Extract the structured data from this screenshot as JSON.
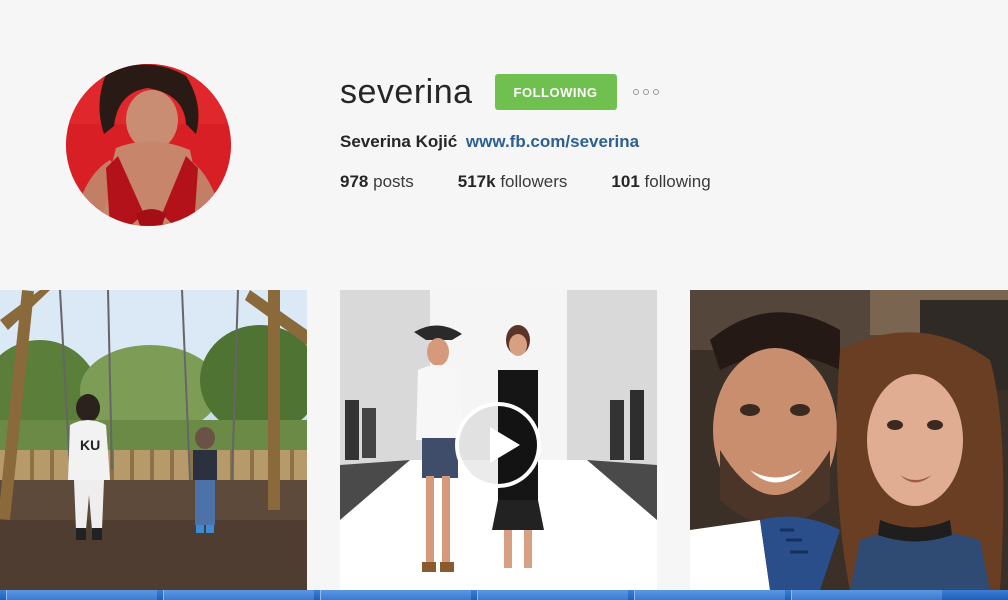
{
  "profile": {
    "username": "severina",
    "follow_label": "FOLLOWING",
    "more_label": "•••",
    "full_name": "Severina Kojić",
    "link": "www.fb.com/severina",
    "stats": {
      "posts_count": "978",
      "posts_label": "posts",
      "followers_count": "517k",
      "followers_label": "followers",
      "following_count": "101",
      "following_label": "following"
    }
  },
  "posts": [
    {
      "kind": "photo",
      "icon": "playground-photo"
    },
    {
      "kind": "video",
      "icon": "play-icon"
    },
    {
      "kind": "photo",
      "icon": "selfie-photo"
    }
  ],
  "colors": {
    "follow_button": "#70c050",
    "link": "#2d5f93",
    "background": "#f6f6f6",
    "taskbar": "#2a6cc6"
  }
}
